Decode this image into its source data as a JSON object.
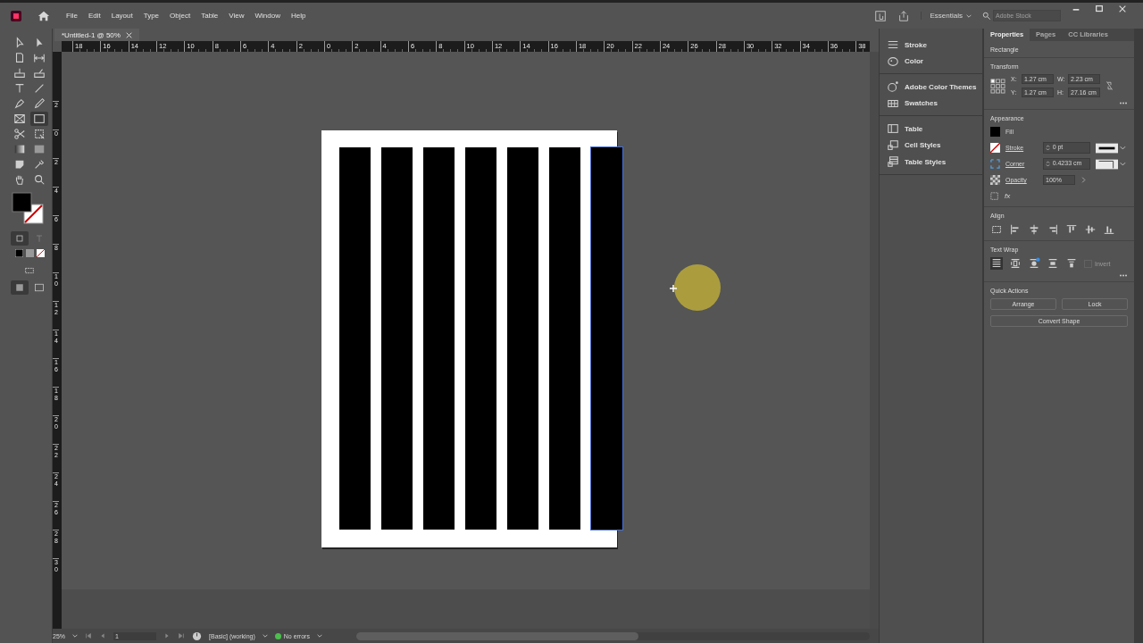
{
  "menu_bar": {
    "items": [
      "File",
      "Edit",
      "Layout",
      "Type",
      "Object",
      "Table",
      "View",
      "Window",
      "Help"
    ],
    "workspace": "Essentials",
    "search": {
      "placeholder": "Adobe Stock"
    }
  },
  "document_tab": {
    "title": "*Untitled-1 @ 50%"
  },
  "tools": [
    {
      "kind": "selection",
      "selected": false
    },
    {
      "kind": "direct",
      "selected": false
    },
    {
      "kind": "page",
      "selected": false
    },
    {
      "kind": "gap",
      "selected": false
    },
    {
      "kind": "collector",
      "selected": false
    },
    {
      "kind": "placer",
      "selected": false
    },
    {
      "kind": "type",
      "selected": false
    },
    {
      "kind": "line",
      "selected": false
    },
    {
      "kind": "pen",
      "selected": false
    },
    {
      "kind": "pencil",
      "selected": false
    },
    {
      "kind": "frame",
      "selected": false
    },
    {
      "kind": "rectangle",
      "selected": true
    },
    {
      "kind": "scissors",
      "selected": false
    },
    {
      "kind": "transform",
      "selected": false
    },
    {
      "kind": "gradient",
      "selected": false
    },
    {
      "kind": "feather",
      "selected": false
    },
    {
      "kind": "note",
      "selected": false
    },
    {
      "kind": "eyedropper",
      "selected": false
    },
    {
      "kind": "hand",
      "selected": false
    },
    {
      "kind": "zoom",
      "selected": false
    }
  ],
  "rulers": {
    "horizontal": [
      "18",
      "16",
      "14",
      "12",
      "10",
      "8",
      "6",
      "4",
      "2",
      "0",
      "2",
      "4",
      "6",
      "8",
      "10",
      "12",
      "14",
      "16",
      "18",
      "20",
      "22",
      "24",
      "26",
      "28",
      "30",
      "32",
      "34",
      "36",
      "38"
    ],
    "vertical": [
      "2",
      "0",
      "2",
      "4",
      "6",
      "8",
      "10",
      "12",
      "14",
      "16",
      "18",
      "20",
      "22",
      "24",
      "26",
      "28",
      "30"
    ]
  },
  "panel_dock": {
    "groups": [
      [
        {
          "kind": "stroke",
          "label": "Stroke"
        },
        {
          "kind": "color",
          "label": "Color"
        }
      ],
      [
        {
          "kind": "themes",
          "label": "Adobe Color Themes"
        },
        {
          "kind": "swatches",
          "label": "Swatches"
        }
      ],
      [
        {
          "kind": "table",
          "label": "Table"
        },
        {
          "kind": "cell",
          "label": "Cell Styles"
        },
        {
          "kind": "tablestyles",
          "label": "Table Styles"
        }
      ]
    ]
  },
  "properties": {
    "tabs": [
      {
        "label": "Properties",
        "selected": true
      },
      {
        "label": "Pages",
        "selected": false
      },
      {
        "label": "CC Libraries",
        "selected": false
      }
    ],
    "object_type": "Rectangle",
    "transform": {
      "title": "Transform",
      "fields": [
        {
          "label": "X:",
          "value": "1.27 cm"
        },
        {
          "label": "W:",
          "value": "2.23 cm"
        },
        {
          "label": "Y:",
          "value": "1.27 cm"
        },
        {
          "label": "H:",
          "value": "27.16 cm"
        }
      ]
    },
    "appearance": {
      "title": "Appearance",
      "fill": "Fill",
      "rows": [
        {
          "kind": "stroke",
          "label": "Stroke",
          "value": "0 pt"
        },
        {
          "kind": "corner",
          "label": "Corner",
          "value": "0.4233 cm"
        },
        {
          "kind": "opacity",
          "label": "Opacity",
          "value": "100%"
        }
      ],
      "effects": "fx"
    },
    "align": {
      "title": "Align"
    },
    "text_wrap": {
      "title": "Text Wrap",
      "invert": {
        "label": "Invert",
        "checked": false,
        "disabled": true
      }
    },
    "quick_actions": {
      "title": "Quick Actions",
      "buttons": [
        "Arrange",
        "Lock",
        "Convert Shape"
      ]
    }
  },
  "status_bar": {
    "zoom": "25%",
    "page": "1",
    "profile": "[Basic] (working)",
    "errors": "No errors"
  }
}
